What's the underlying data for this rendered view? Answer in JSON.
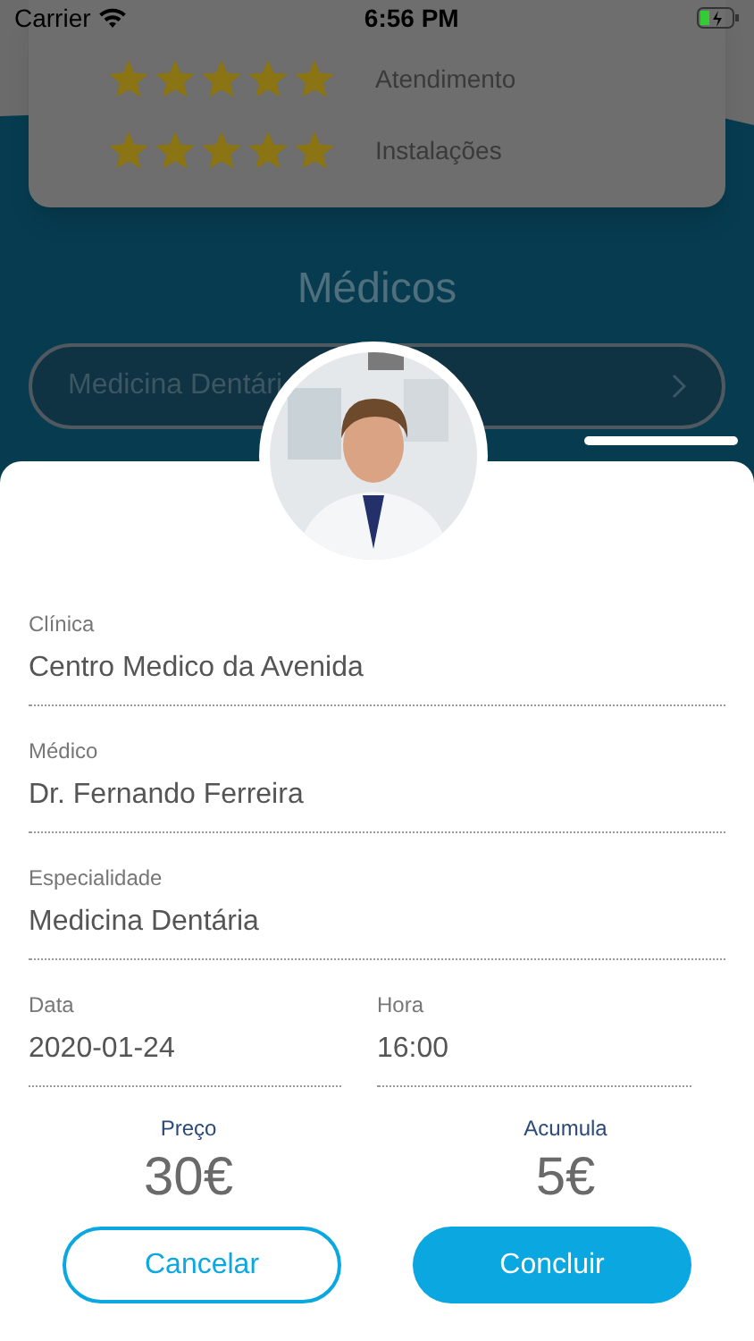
{
  "status_bar": {
    "carrier": "Carrier",
    "time": "6:56 PM"
  },
  "ratings": [
    {
      "label": "Atendimento",
      "stars": 5
    },
    {
      "label": "Instalações",
      "stars": 5
    }
  ],
  "section_title": "Médicos",
  "specialty_select": {
    "value": "Medicina Dentári"
  },
  "form": {
    "fields": [
      {
        "label": "Clínica",
        "value": "Centro Medico da Avenida"
      },
      {
        "label": "Médico",
        "value": "Dr. Fernando Ferreira"
      },
      {
        "label": "Especialidade",
        "value": "Medicina Dentária"
      }
    ],
    "date": {
      "label": "Data",
      "value": "2020-01-24"
    },
    "time": {
      "label": "Hora",
      "value": "16:00"
    }
  },
  "price": {
    "label": "Preço",
    "value": "30€"
  },
  "points": {
    "label": "Acumula",
    "value": "5€"
  },
  "buttons": [
    {
      "label": "Cancelar",
      "kind": "outline"
    },
    {
      "label": "Concluir",
      "kind": "filled"
    }
  ]
}
